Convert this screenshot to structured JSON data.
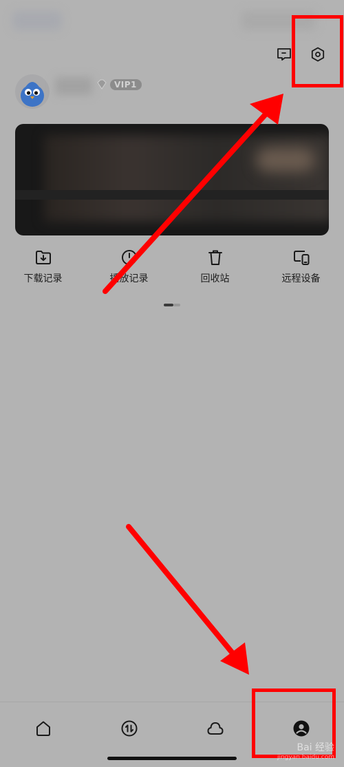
{
  "header": {
    "message_icon": "message-icon",
    "settings_icon": "settings-icon"
  },
  "profile": {
    "vip_label": "VIP1"
  },
  "quick_actions": [
    {
      "label": "下载记录",
      "icon": "download-folder-icon"
    },
    {
      "label": "播放记录",
      "icon": "play-history-icon"
    },
    {
      "label": "回收站",
      "icon": "trash-icon"
    },
    {
      "label": "远程设备",
      "icon": "remote-devices-icon"
    }
  ],
  "bottom_nav": [
    {
      "icon": "home-icon"
    },
    {
      "icon": "transfer-icon"
    },
    {
      "icon": "cloud-icon"
    },
    {
      "icon": "profile-icon",
      "active": true
    }
  ],
  "annotation": {
    "color": "#ff0000",
    "watermark": "Bai 经验",
    "watermark_sub": "jingyan.baidu.com"
  }
}
